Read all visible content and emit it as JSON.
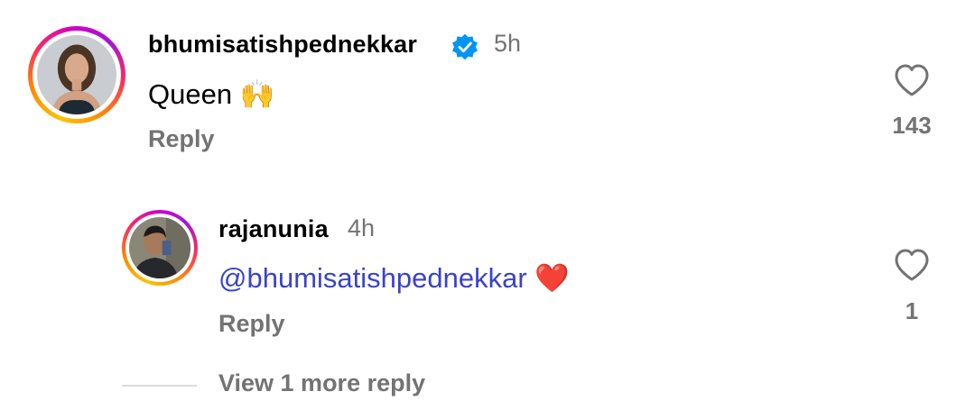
{
  "comments": [
    {
      "username": "bhumisatishpednekkar",
      "verified": true,
      "time": "5h",
      "text": "Queen",
      "emoji": "🙌",
      "reply_label": "Reply",
      "like_count": "143"
    }
  ],
  "replies": [
    {
      "username": "rajanunia",
      "time": "4h",
      "mention": "@bhumisatishpednekkar",
      "emoji": "❤️",
      "reply_label": "Reply",
      "like_count": "1"
    }
  ],
  "view_more_label": "View 1 more reply",
  "colors": {
    "verified_badge": "#0095f6",
    "mention": "#3a43c9",
    "secondary_text": "#737373",
    "heart_emoji": "#e0245e"
  }
}
